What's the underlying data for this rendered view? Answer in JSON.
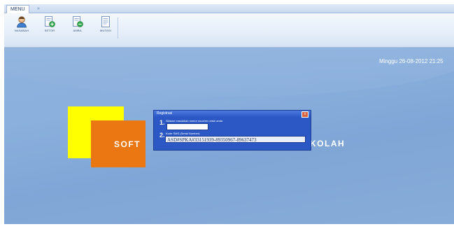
{
  "tabs": [
    {
      "label": "MENU"
    },
    {
      "label": "»"
    }
  ],
  "ribbon": {
    "buttons": [
      {
        "label": "NASABAH",
        "icon": "user-icon"
      },
      {
        "label": "SETOR",
        "icon": "deposit-icon"
      },
      {
        "label": "AMBIL",
        "icon": "withdraw-icon"
      },
      {
        "label": "MUTASI",
        "icon": "mutation-icon"
      }
    ]
  },
  "status": {
    "datetime": "Minggu  26-08-2012  21:25"
  },
  "logo": {
    "left_text": "SOFT",
    "right_text": "KOLAH"
  },
  "dialog": {
    "title": "Registrasi",
    "close_label": "x",
    "step1_number": "1.",
    "step1_text": "Silakan masukkan nomor voucher untuk anda",
    "voucher_value": "",
    "step2_number": "2.",
    "step2_text": "Kode SMS (Serial Number)",
    "serial_value": "ASD#SPKA#33151939-89350967-89637473"
  },
  "colors": {
    "desktop": "#8bb0de",
    "logo_yellow": "#ffff00",
    "logo_orange": "#ea7711",
    "dialog_blue": "#2b58c4"
  }
}
